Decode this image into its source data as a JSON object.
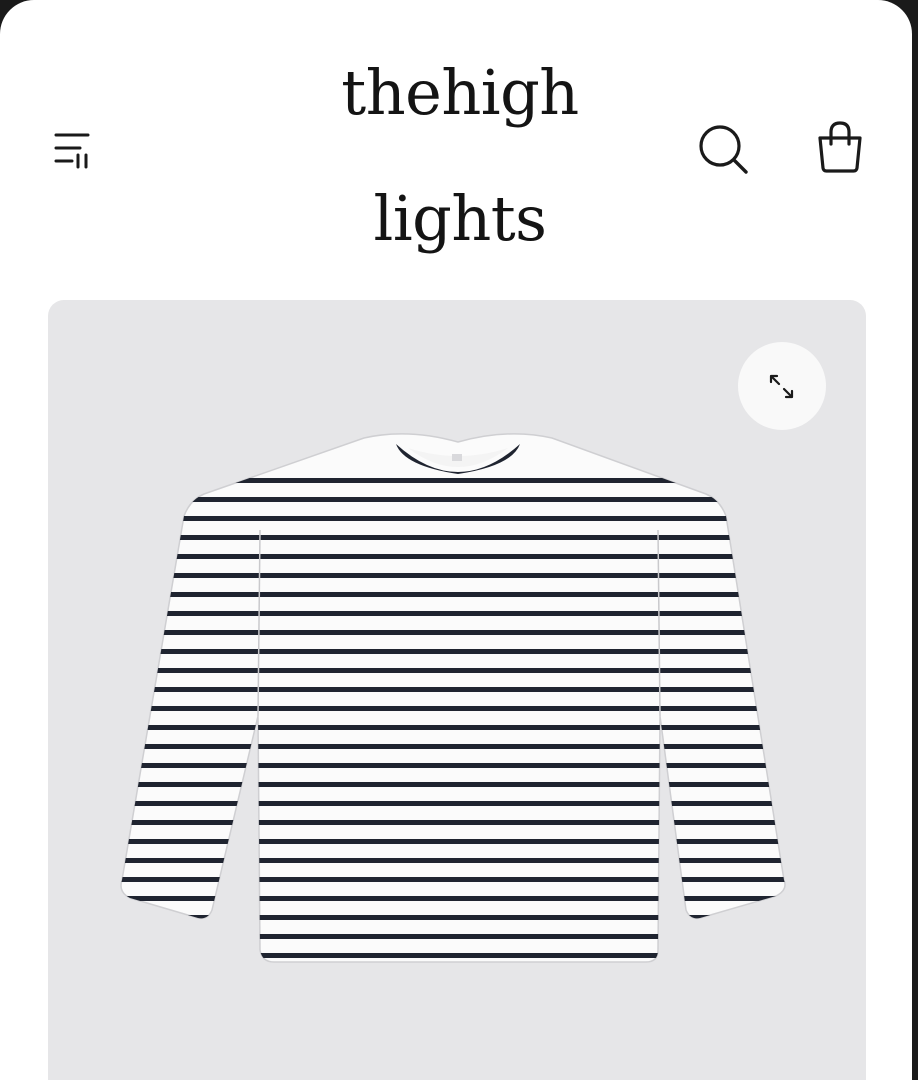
{
  "store": {
    "logo_line1": "thehigh",
    "logo_line2": "lights"
  },
  "header": {
    "menu_icon": "menu-icon",
    "search_icon": "search-icon",
    "cart_icon": "shopping-bag-icon"
  },
  "product": {
    "image_subject": "striped-long-sleeve-tee",
    "zoom_icon": "expand-icon"
  },
  "colors": {
    "page_background": "#ffffff",
    "card_background": "#e6e6e8",
    "stripe": "#1f2430",
    "text": "#141414"
  }
}
